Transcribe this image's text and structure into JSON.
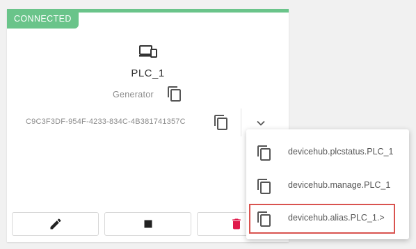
{
  "device": {
    "status_badge": "CONNECTED",
    "name": "PLC_1",
    "type": "Generator",
    "uuid": "C9C3F3DF-954F-4233-834C-4B381741357C"
  },
  "icons": {
    "device": "devices-icon",
    "copy": "copy-icon",
    "expand": "chevron-down-icon",
    "edit": "pencil-icon",
    "stop": "stop-icon",
    "delete": "trash-icon"
  },
  "dropdown": {
    "items": [
      {
        "label": "devicehub.plcstatus.PLC_1"
      },
      {
        "label": "devicehub.manage.PLC_1"
      },
      {
        "label": "devicehub.alias.PLC_1.>"
      }
    ]
  },
  "colors": {
    "connected": "#6ac48a",
    "delete": "#e0194a",
    "highlight": "#d9534f"
  }
}
